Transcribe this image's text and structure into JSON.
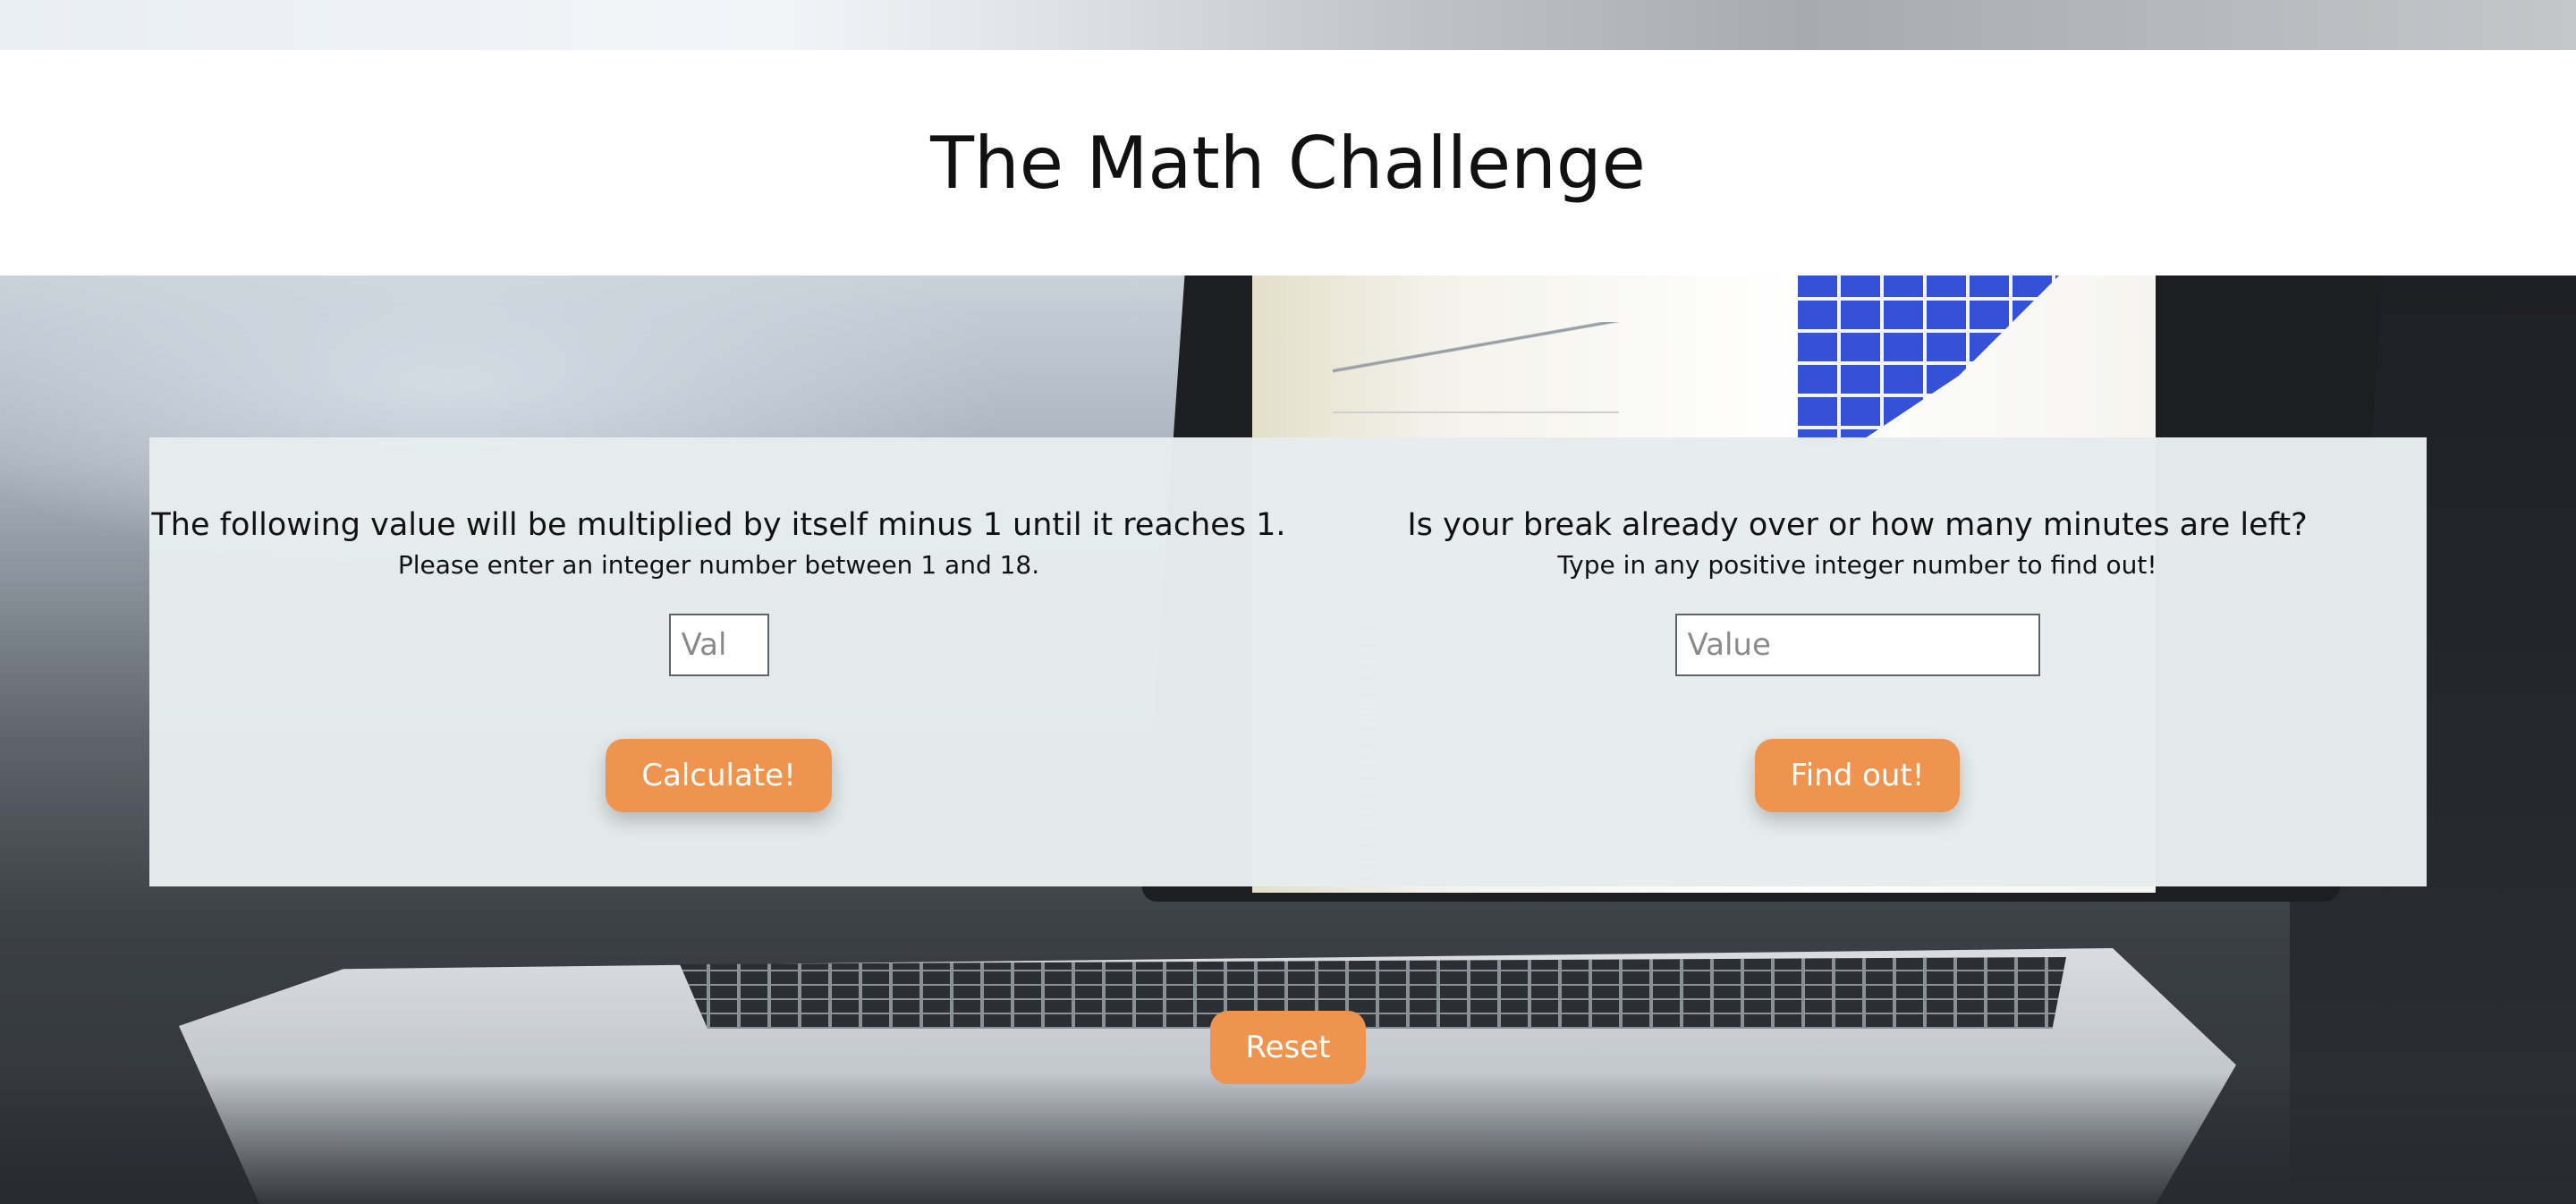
{
  "header": {
    "title": "The Math Challenge"
  },
  "factorial_panel": {
    "prompt": "The following value will be multiplied by itself minus 1 until it reaches 1.",
    "hint": "Please enter an integer number between 1 and 18.",
    "input_placeholder": "Val",
    "input_value": "",
    "button_label": "Calculate!"
  },
  "break_panel": {
    "prompt": "Is your break already over or how many minutes are left?",
    "hint": "Type in any positive integer number to find out!",
    "input_placeholder": "Value",
    "input_value": "",
    "button_label": "Find out!"
  },
  "reset_label": "Reset",
  "colors": {
    "button": "#ef944f",
    "panel": "#e7edee",
    "header": "#ffffff"
  }
}
